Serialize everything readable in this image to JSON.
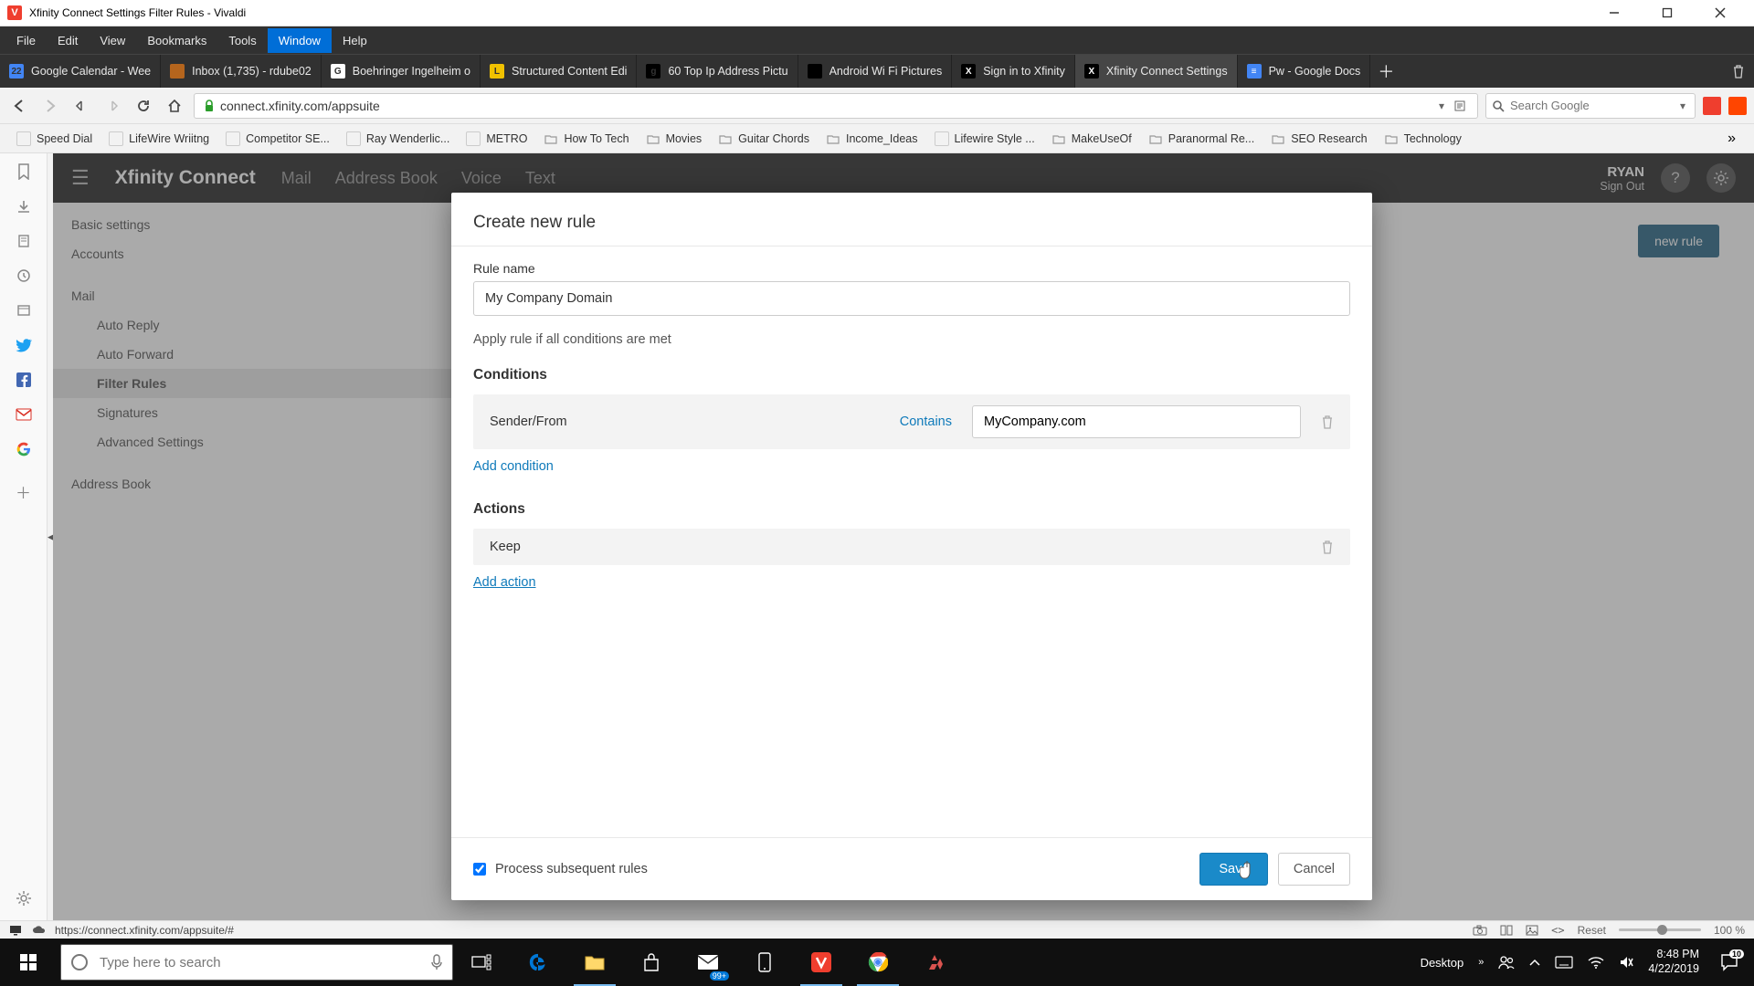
{
  "titlebar": {
    "text": "Xfinity Connect Settings Filter Rules - Vivaldi"
  },
  "menubar": [
    "File",
    "Edit",
    "View",
    "Bookmarks",
    "Tools",
    "Window",
    "Help"
  ],
  "menubar_active_index": 5,
  "tabs": [
    {
      "label": "Google Calendar - Wee",
      "color": "#4285f4",
      "ch": "22"
    },
    {
      "label": "Inbox (1,735) - rdube02",
      "color": "#b5651d",
      "ch": ""
    },
    {
      "label": "Boehringer Ingelheim o",
      "color": "#fff",
      "ch": "G"
    },
    {
      "label": "Structured Content Edi",
      "color": "#f0c100",
      "ch": "L"
    },
    {
      "label": "60 Top Ip Address Pictu",
      "color": "#000",
      "ch": "g"
    },
    {
      "label": "Android Wi Fi Pictures ",
      "color": "#000",
      "ch": ""
    },
    {
      "label": "Sign in to Xfinity",
      "color": "#000",
      "ch": "X",
      "icontext": "#fff"
    },
    {
      "label": "Xfinity Connect Settings",
      "color": "#000",
      "ch": "X",
      "icontext": "#fff",
      "active": true
    },
    {
      "label": "Pw - Google Docs",
      "color": "#4285f4",
      "ch": "≡",
      "icontext": "#fff"
    }
  ],
  "url": "connect.xfinity.com/appsuite",
  "search_placeholder": "Search Google",
  "bookmarks": [
    {
      "label": "Speed Dial",
      "icon": "sq"
    },
    {
      "label": "LifeWire Wriitng",
      "icon": "sq"
    },
    {
      "label": "Competitor SE...",
      "icon": "sq"
    },
    {
      "label": "Ray Wenderlic...",
      "icon": "sq"
    },
    {
      "label": "METRO",
      "icon": "sq"
    },
    {
      "label": "How To Tech",
      "icon": "folder"
    },
    {
      "label": "Movies",
      "icon": "folder"
    },
    {
      "label": "Guitar Chords",
      "icon": "folder"
    },
    {
      "label": "Income_Ideas",
      "icon": "folder"
    },
    {
      "label": "Lifewire Style ...",
      "icon": "sq"
    },
    {
      "label": "MakeUseOf",
      "icon": "folder"
    },
    {
      "label": "Paranormal Re...",
      "icon": "folder"
    },
    {
      "label": "SEO Research",
      "icon": "folder"
    },
    {
      "label": "Technology",
      "icon": "folder"
    }
  ],
  "app": {
    "brand": "Xfinity Connect",
    "nav": [
      "Mail",
      "Address Book",
      "Voice",
      "Text"
    ],
    "user": "RYAN",
    "signout": "Sign Out"
  },
  "sidebar": {
    "items": [
      {
        "label": "Basic settings"
      },
      {
        "label": "Accounts"
      },
      {
        "spacer": true
      },
      {
        "label": "Mail"
      },
      {
        "label": "Auto Reply",
        "indent": true
      },
      {
        "label": "Auto Forward",
        "indent": true
      },
      {
        "label": "Filter Rules",
        "indent": true,
        "active": true
      },
      {
        "label": "Signatures",
        "indent": true
      },
      {
        "label": "Advanced Settings",
        "indent": true
      },
      {
        "spacer": true
      },
      {
        "label": "Address Book"
      }
    ]
  },
  "newrule_btn": "new rule",
  "modal": {
    "title": "Create new rule",
    "rule_name_label": "Rule name",
    "rule_name_value": "My Company Domain",
    "apply_text": "Apply rule if all conditions are met",
    "conditions_title": "Conditions",
    "condition": {
      "field": "Sender/From",
      "op": "Contains",
      "value": "MyCompany.com"
    },
    "add_condition": "Add condition",
    "actions_title": "Actions",
    "action": "Keep",
    "add_action": "Add action",
    "process_label": "Process subsequent rules",
    "save": "Save",
    "cancel": "Cancel"
  },
  "statusbar": {
    "url": "https://connect.xfinity.com/appsuite/#",
    "reset": "Reset",
    "zoom": "100 %"
  },
  "taskbar": {
    "search_placeholder": "Type here to search",
    "desktop": "Desktop",
    "time": "8:48 PM",
    "date": "4/22/2019",
    "notif_count": "10",
    "mail_badge": "99+"
  }
}
